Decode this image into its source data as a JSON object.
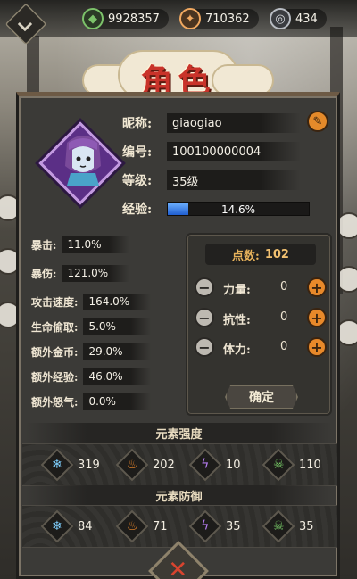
{
  "currency": {
    "jade": {
      "value": "9928357",
      "icon": "green-jade-icon",
      "color": "#7cc26a"
    },
    "coin": {
      "value": "710362",
      "icon": "copper-coin-icon",
      "color": "#f0a860"
    },
    "silver": {
      "value": "434",
      "icon": "silver-coin-icon",
      "color": "#b8bcc2"
    }
  },
  "title": "角色",
  "profile": {
    "nickname_label": "昵称:",
    "nickname": "giaogiao",
    "id_label": "编号:",
    "id": "100100000004",
    "level_label": "等级:",
    "level": "35级",
    "exp_label": "经验:",
    "exp_text": "14.6%",
    "exp_fraction": 0.146
  },
  "stats": [
    {
      "label": "暴击:",
      "value": "11.0%"
    },
    {
      "label": "暴伤:",
      "value": "121.0%"
    },
    {
      "label": "攻击速度:",
      "value": "164.0%"
    },
    {
      "label": "生命偷取:",
      "value": "5.0%"
    },
    {
      "label": "额外金币:",
      "value": "29.0%"
    },
    {
      "label": "额外经验:",
      "value": "46.0%"
    },
    {
      "label": "额外怒气:",
      "value": "0.0%"
    }
  ],
  "points": {
    "label": "点数:",
    "value": "102",
    "attributes": [
      {
        "label": "力量:",
        "value": "0"
      },
      {
        "label": "抗性:",
        "value": "0"
      },
      {
        "label": "体力:",
        "value": "0"
      }
    ],
    "confirm_label": "确定"
  },
  "element_strength": {
    "title": "元素强度",
    "items": [
      {
        "icon": "ice-icon",
        "value": "319",
        "color": "#7fd0ff"
      },
      {
        "icon": "fire-icon",
        "value": "202",
        "color": "#f08a2c"
      },
      {
        "icon": "lightning-icon",
        "value": "10",
        "color": "#b57cf0"
      },
      {
        "icon": "poison-icon",
        "value": "110",
        "color": "#7bd06a"
      }
    ]
  },
  "element_defense": {
    "title": "元素防御",
    "items": [
      {
        "icon": "ice-icon",
        "value": "84",
        "color": "#7fd0ff"
      },
      {
        "icon": "fire-icon",
        "value": "71",
        "color": "#f08a2c"
      },
      {
        "icon": "lightning-icon",
        "value": "35",
        "color": "#b57cf0"
      },
      {
        "icon": "poison-icon",
        "value": "35",
        "color": "#7bd06a"
      }
    ]
  }
}
